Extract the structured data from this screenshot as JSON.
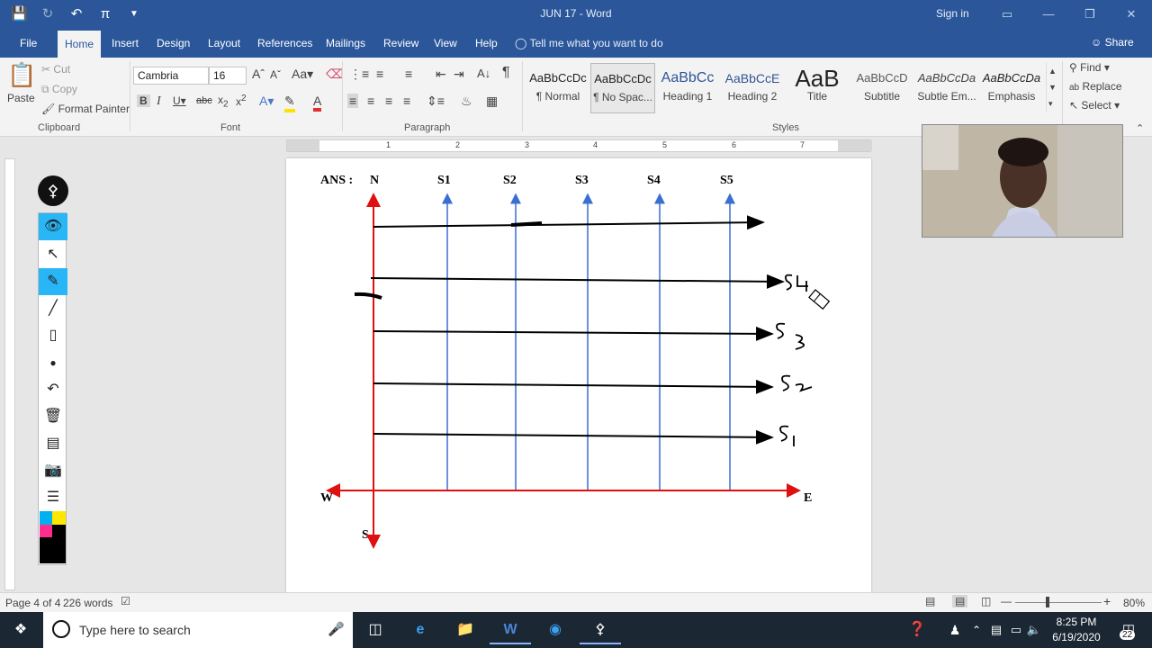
{
  "window": {
    "doc_title": "JUN 17  -  Word",
    "sign_in": "Sign in"
  },
  "tabs": [
    "File",
    "Home",
    "Insert",
    "Design",
    "Layout",
    "References",
    "Mailings",
    "Review",
    "View",
    "Help"
  ],
  "tell_me": "Tell me what you want to do",
  "share": "Share",
  "clipboard": {
    "paste": "Paste",
    "cut": "Cut",
    "copy": "Copy",
    "format_painter": "Format Painter",
    "group": "Clipboard"
  },
  "font": {
    "name": "Cambria",
    "size": "16",
    "group": "Font"
  },
  "paragraph": {
    "group": "Paragraph"
  },
  "styles": {
    "group": "Styles",
    "items": [
      {
        "sample": "AaBbCcDc",
        "name": "¶ Normal"
      },
      {
        "sample": "AaBbCcDc",
        "name": "¶ No Spac..."
      },
      {
        "sample": "AaBbCc",
        "name": "Heading 1"
      },
      {
        "sample": "AaBbCcE",
        "name": "Heading 2"
      },
      {
        "sample": "AaB",
        "name": "Title"
      },
      {
        "sample": "AaBbCcD",
        "name": "Subtitle"
      },
      {
        "sample": "AaBbCcDa",
        "name": "Subtle Em..."
      },
      {
        "sample": "AaBbCcDa",
        "name": "Emphasis"
      }
    ]
  },
  "editing": {
    "find": "Find",
    "replace": "Replace",
    "select": "Select"
  },
  "ruler": [
    "1",
    "2",
    "3",
    "4",
    "5",
    "6",
    "7"
  ],
  "diagram": {
    "ans": "ANS :",
    "top_labels": [
      "N",
      "S1",
      "S2",
      "S3",
      "S4",
      "S5"
    ],
    "west": "W",
    "east": "E",
    "south": "S",
    "handwritten": [
      "S4",
      "S3",
      "S2",
      "S1"
    ]
  },
  "status": {
    "page": "Page 4 of 4",
    "words": "226 words",
    "zoom": "80%"
  },
  "taskbar": {
    "search_placeholder": "Type here to search",
    "time": "8:25 PM",
    "date": "6/19/2020",
    "notifications": "22"
  }
}
